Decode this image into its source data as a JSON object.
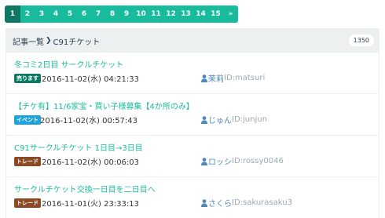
{
  "pagination": {
    "pages": [
      "1",
      "2",
      "3",
      "4",
      "5",
      "6",
      "7",
      "8",
      "9",
      "10",
      "11",
      "12",
      "13",
      "14",
      "15"
    ],
    "active": "1",
    "next_label": "»"
  },
  "breadcrumb": {
    "root": "記事一覧",
    "separator": "❯",
    "current": "C91チケット"
  },
  "post_count": "1350",
  "colors": {
    "accent": "#18bc9c",
    "active_page": "#0f7864",
    "user_blue": "#4e87b8"
  },
  "posts": [
    {
      "title": "冬コミ2日目 サークルチケット",
      "category": "売ります",
      "category_color": "#0f7864",
      "date": "2016-11-02(水) 04:21:33",
      "user_name": "茉莉",
      "user_id": "ID:matsuri"
    },
    {
      "title": "【チケ有】11/6家宝・買い子様募集【4か所のみ】",
      "category": "イベント",
      "category_color": "#1ca3dc",
      "date": "2016-11-02(水) 00:57:43",
      "user_name": "じゅん",
      "user_id": "ID:junjun"
    },
    {
      "title": "C91サークルチケット 1日目→3日目",
      "category": "トレード",
      "category_color": "#8b4a24",
      "date": "2016-11-02(水) 00:06:03",
      "user_name": "ロッシ",
      "user_id": "ID:rossy0046"
    },
    {
      "title": "サークルチケット交換一日目を二日目へ",
      "category": "トレード",
      "category_color": "#8b4a24",
      "date": "2016-11-01(火) 23:33:13",
      "user_name": "さくら",
      "user_id": "ID:sakurasaku3"
    }
  ]
}
